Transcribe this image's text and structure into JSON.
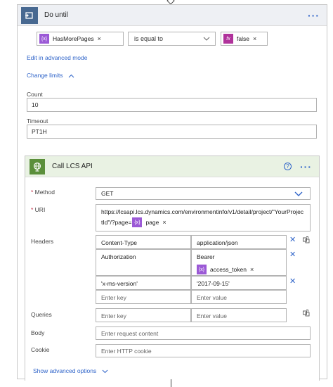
{
  "do_until": {
    "title": "Do until",
    "left_token": "HasMorePages",
    "operator": "is equal to",
    "right_token": "false",
    "edit_advanced": "Edit in advanced mode",
    "change_limits": "Change limits",
    "count_label": "Count",
    "count_value": "10",
    "timeout_label": "Timeout",
    "timeout_value": "PT1H"
  },
  "action": {
    "title": "Call LCS API",
    "method_label": "Method",
    "method_value": "GET",
    "uri_label": "URI",
    "uri_line1": "https://lcsapi.lcs.dynamics.com/environmentinfo/v1/detail/project/\"YourProjec",
    "uri_line2": "tId\"/?page=",
    "uri_token": "page",
    "headers_label": "Headers",
    "headers": [
      {
        "key": "Content-Type",
        "value": "application/json"
      },
      {
        "key": "Authorization",
        "value": "Bearer"
      },
      {
        "key": "'x-ms-version'",
        "value": "'2017-09-15'"
      }
    ],
    "auth_token": "access_token",
    "key_placeholder": "Enter key",
    "value_placeholder": "Enter value",
    "queries_label": "Queries",
    "body_label": "Body",
    "body_placeholder": "Enter request content",
    "cookie_label": "Cookie",
    "cookie_placeholder": "Enter HTTP cookie",
    "show_advanced": "Show advanced options"
  },
  "colors": {
    "variable_token": "#9b59d6",
    "expression_token": "#b0329b",
    "loop_icon": "#486991",
    "http_icon": "#5b8f3b",
    "link": "#2f64c9"
  },
  "icons": {
    "loop": "loop-icon",
    "variable": "variable-icon",
    "expression": "fx-icon",
    "http": "globe-icon"
  }
}
